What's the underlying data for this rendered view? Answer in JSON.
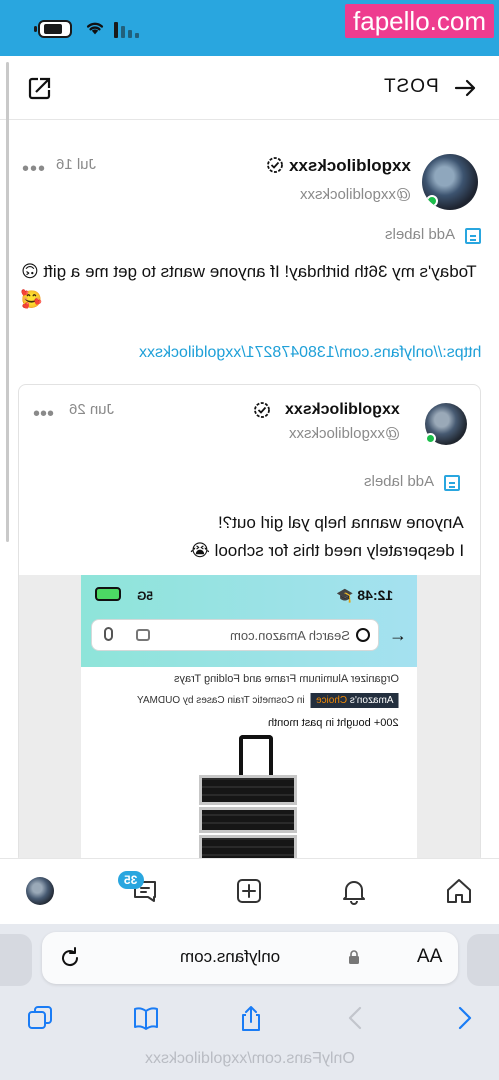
{
  "status_bar": {
    "watermark": "fapello.com",
    "battery_icon": "battery-icon",
    "wifi_icon": "wifi-icon",
    "signal_icon": "signal-icon"
  },
  "header": {
    "title": "POST",
    "back_icon": "arrow-icon",
    "share_icon": "share-icon"
  },
  "post": {
    "display_name": "xxgoldilocksxx",
    "handle": "@xxgoldilocksxx",
    "date": "Jul 16",
    "more": "•••",
    "labels_text": "Add labels",
    "text": "Today's my 36th birthday! If anyone wants to get me a gift 🙃🥰",
    "link": "https://onlyfans.com/1380478271/xxgoldilocksxx"
  },
  "quoted_post": {
    "display_name": "xxgoldilocksxx",
    "handle": "@xxgoldilocksxx",
    "date": "Jun 26",
    "more": "•••",
    "labels_text": "Add labels",
    "text_line1": "Anyone wanna help yal girl out?!",
    "text_line2": "I desperately need this for school 😭",
    "media": {
      "time": "12:48 🎓",
      "network": "5G",
      "search_placeholder": "Search Amazon.com",
      "product_line": "Organizer Aluminum Frame and Folding Trays",
      "choice_badge_a": "Amazon's",
      "choice_badge_b": "Choice",
      "choice_context": "in Cosmetic Train Cases by OUDMAY",
      "bought": "200+ bought in past month"
    }
  },
  "bottom_nav": {
    "messages_badge": "35",
    "items": [
      "avatar",
      "messages-icon",
      "add-icon",
      "bell-icon",
      "home-icon"
    ]
  },
  "browser": {
    "address": "onlyfans.com",
    "aa_label": "AA",
    "footer_url": "OnlyFans.com/xxgoldilocksxx"
  },
  "colors": {
    "accent": "#29a6df",
    "online": "#1bbf4b",
    "watermark_bg": "#ee3c8f"
  }
}
